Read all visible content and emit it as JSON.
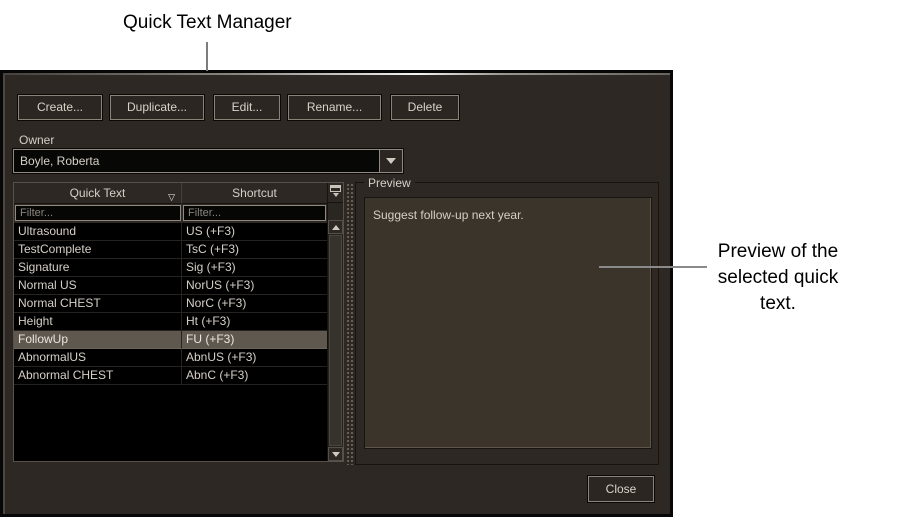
{
  "annotations": {
    "title": "Quick Text Manager",
    "preview_note": "Preview of the selected quick text."
  },
  "toolbar": {
    "create_label": "Create...",
    "duplicate_label": "Duplicate...",
    "edit_label": "Edit...",
    "rename_label": "Rename...",
    "delete_label": "Delete"
  },
  "owner": {
    "label": "Owner",
    "selected_value": "Boyle, Roberta"
  },
  "table": {
    "columns": [
      {
        "label": "Quick Text",
        "filter_placeholder": "Filter..."
      },
      {
        "label": "Shortcut",
        "filter_placeholder": "Filter..."
      }
    ],
    "sort_indicator": "▽",
    "rows": [
      {
        "quick_text": "Ultrasound",
        "shortcut": "US (+F3)"
      },
      {
        "quick_text": "TestComplete",
        "shortcut": "TsC (+F3)"
      },
      {
        "quick_text": "Signature",
        "shortcut": "Sig (+F3)"
      },
      {
        "quick_text": "Normal US",
        "shortcut": "NorUS (+F3)"
      },
      {
        "quick_text": "Normal CHEST",
        "shortcut": "NorC (+F3)"
      },
      {
        "quick_text": "Height",
        "shortcut": "Ht (+F3)"
      },
      {
        "quick_text": "FollowUp",
        "shortcut": "FU (+F3)"
      },
      {
        "quick_text": "AbnormalUS",
        "shortcut": "AbnUS (+F3)"
      },
      {
        "quick_text": "Abnormal CHEST",
        "shortcut": "AbnC (+F3)"
      }
    ],
    "selected_row_index": 6
  },
  "preview": {
    "label": "Preview",
    "content": "Suggest follow-up next year."
  },
  "footer": {
    "close_label": "Close"
  },
  "colors": {
    "dialog_bg": "#2d2824",
    "selection_bg": "#5f584e",
    "text_light": "#d5d0c7",
    "preview_bg": "#3b342b",
    "row_bg": "#000000",
    "annotation_text": "#000000",
    "callout_line": "#808080"
  }
}
